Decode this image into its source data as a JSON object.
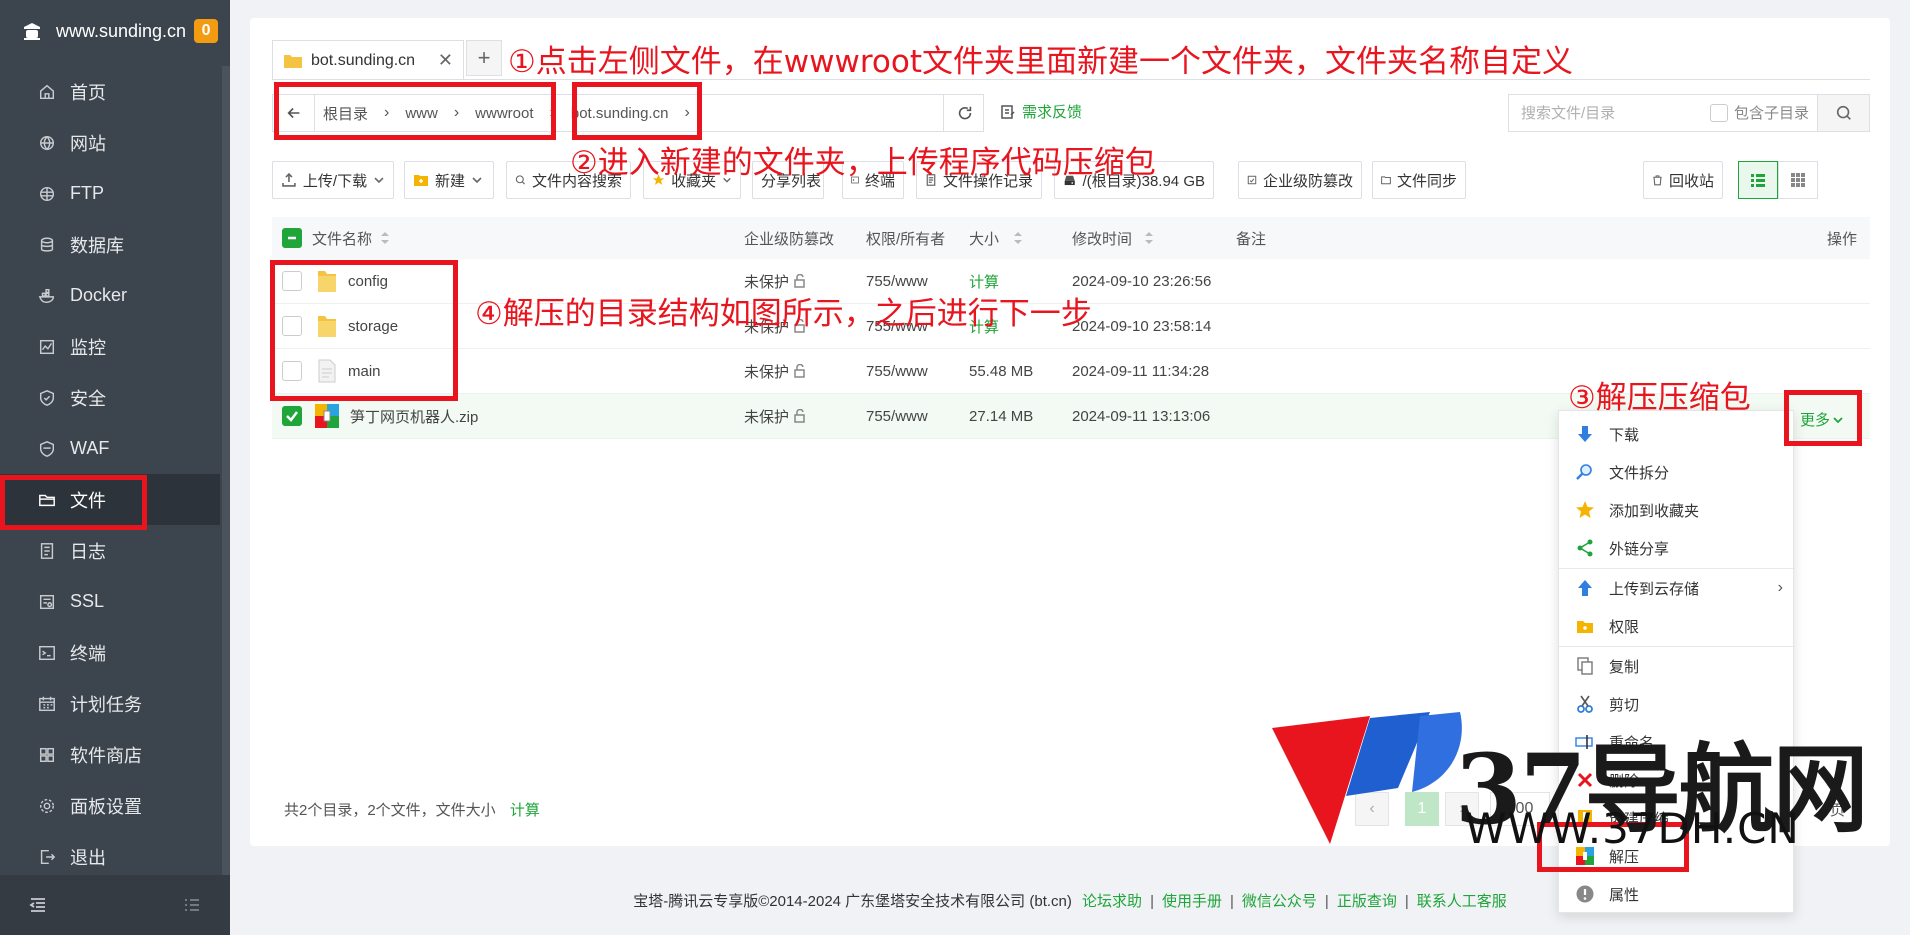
{
  "sidebar": {
    "brand": "www.sunding.cn",
    "badge": "0",
    "items": [
      {
        "label": "首页"
      },
      {
        "label": "网站"
      },
      {
        "label": "FTP"
      },
      {
        "label": "数据库"
      },
      {
        "label": "Docker"
      },
      {
        "label": "监控"
      },
      {
        "label": "安全"
      },
      {
        "label": "WAF"
      },
      {
        "label": "文件"
      },
      {
        "label": "日志"
      },
      {
        "label": "SSL"
      },
      {
        "label": "终端"
      },
      {
        "label": "计划任务"
      },
      {
        "label": "软件商店"
      },
      {
        "label": "面板设置"
      },
      {
        "label": "退出"
      }
    ]
  },
  "tabs": {
    "active": "bot.sunding.cn",
    "close": "✕",
    "add": "+"
  },
  "path": {
    "crumbs": [
      "根目录",
      "www",
      "wwwroot",
      "bot.sunding.cn"
    ],
    "feedback": "需求反馈"
  },
  "search": {
    "placeholder": "搜索文件/目录",
    "include_sub": "包含子目录"
  },
  "toolbar": {
    "upload": "上传/下载",
    "new": "新建",
    "content_search": "文件内容搜索",
    "favorites": "收藏夹",
    "share_list": "分享列表",
    "terminal": "终端",
    "op_log": "文件操作记录",
    "disk": "/(根目录)38.94 GB",
    "anti_tamper": "企业级防篡改",
    "sync": "文件同步",
    "recycle": "回收站"
  },
  "table": {
    "headers": {
      "name": "文件名称",
      "protect": "企业级防篡改",
      "perm": "权限/所有者",
      "size": "大小",
      "mtime": "修改时间",
      "note": "备注",
      "action": "操作"
    },
    "rows": [
      {
        "name": "config",
        "protect": "未保护",
        "perm": "755/www",
        "size": "计算",
        "mtime": "2024-09-10 23:26:56"
      },
      {
        "name": "storage",
        "protect": "未保护",
        "perm": "755/www",
        "size": "计算",
        "mtime": "2024-09-10 23:58:14"
      },
      {
        "name": "main",
        "protect": "未保护",
        "perm": "755/www",
        "size": "55.48 MB",
        "mtime": "2024-09-11 11:34:28"
      },
      {
        "name": "笋丁网页机器人.zip",
        "protect": "未保护",
        "perm": "755/www",
        "size": "27.14 MB",
        "mtime": "2024-09-11 13:13:06"
      }
    ],
    "more": "更多"
  },
  "summary": {
    "text": "共2个目录，2个文件，文件大小",
    "calc": "计算"
  },
  "pager": {
    "prev": "‹",
    "current": "1",
    "next": "›",
    "size": "500",
    "tail": "页"
  },
  "menu": {
    "items": [
      "下载",
      "文件拆分",
      "添加到收藏夹",
      "外链分享",
      "上传到云存储",
      "权限",
      "复制",
      "剪切",
      "重命名",
      "删除",
      "创建压缩",
      "解压",
      "属性"
    ],
    "submenu_arrow": "›"
  },
  "footer": {
    "copyright": "宝塔-腾讯云专享版©2014-2024 广东堡塔安全技术有限公司 (bt.cn)",
    "links": [
      "论坛求助",
      "使用手册",
      "微信公众号",
      "正版查询",
      "联系人工客服"
    ],
    "sep": "|"
  },
  "annotations": {
    "step1": "①点击左侧文件，在wwwroot文件夹里面新建一个文件夹，文件夹名称自定义",
    "step2": "②进入新建的文件夹，上传程序代码压缩包",
    "step3": "③解压压缩包",
    "step4": "④解压的目录结构如图所示，之后进行下一步"
  },
  "watermark": {
    "text": "37导航网",
    "url": "WWW.37DH.CN"
  },
  "colors": {
    "accent": "#20a53a",
    "sidebar_bg": "#3c444d",
    "annotation": "#e8141e",
    "badge": "#f39c12"
  }
}
